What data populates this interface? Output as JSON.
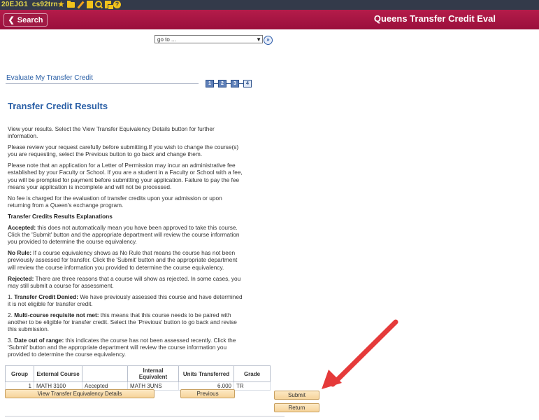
{
  "system": {
    "id": "20EJG1",
    "db": "cs92trn"
  },
  "header": {
    "search_label": "Search",
    "title": "Queens Transfer Credit Eval"
  },
  "goto": {
    "value": "go to ..."
  },
  "breadcrumb": "Evaluate My Transfer Credit",
  "steps": [
    "1",
    "2",
    "3",
    "4"
  ],
  "page_title": "Transfer Credit Results",
  "intro": [
    "View your results. Select the View Transfer Equivalency Details button for further information.",
    "Please review your request carefully before submitting.If you wish to change the course(s) you are requesting, select the Previous button to go back and change them.",
    "Please note that an application for a Letter of Permission may incur an administrative fee established by your Faculty or School. If you are a student in a Faculty or School with a fee, you will be prompted for payment before submitting your application. Failure to pay the fee means your application is incomplete and will not be processed.",
    "No fee is charged for the evaluation of transfer credits upon your admission or upon returning from a Queen's exchange program."
  ],
  "explanations_heading": "Transfer Credits Results Explanations",
  "explanations": [
    {
      "term": "Accepted:",
      "text": " this does not automatically mean you have been approved to take this course. Click the 'Submit' button and the appropriate department will review the course information you provided to determine the course equivalency."
    },
    {
      "term": "No Rule:",
      "text": " If a course equivalency shows as No Rule that means the course has not been previously assessed for transfer. Click the 'Submit' button and the appropriate department will review the course information you provided to determine the course equivalency."
    },
    {
      "term": "Rejected:",
      "text": " There are three reasons that a course will show as rejected. In some cases, you may still submit a course for assessment."
    },
    {
      "term": "Transfer Credit Denied:",
      "prefix": "1. ",
      "text": " We have previously assessed this course and have determined it is not eligible for transfer credit."
    },
    {
      "term": "Multi-course requisite not met:",
      "prefix": "2. ",
      "text": " this means that this course needs to be paired with another to be eligible for transfer credit. Select the 'Previous' button to go back and revise this submission."
    },
    {
      "term": "Date out of range:",
      "prefix": "3. ",
      "text": " this indicates the course has not been assessed recently. Click the 'Submit' button and the appropriate department will review the course information you provided to determine the course equivalency."
    }
  ],
  "table": {
    "headers": [
      "Group",
      "External Course",
      "",
      "Internal Equivalent",
      "Units Transferred",
      "Grade"
    ],
    "rows": [
      {
        "group": "1",
        "external": "MATH 3100",
        "status": "Accepted",
        "internal": "MATH   3UNS",
        "units": "6.000",
        "grade": "TR"
      }
    ]
  },
  "buttons": {
    "view_details": "View Transfer Equivalency Details",
    "previous": "Previous",
    "submit": "Submit",
    "return": "Return"
  },
  "colors": {
    "header": "#b41c4a",
    "link": "#2a5fa6",
    "button": "#f6d49a",
    "annotation_arrow": "#e53a3a"
  }
}
